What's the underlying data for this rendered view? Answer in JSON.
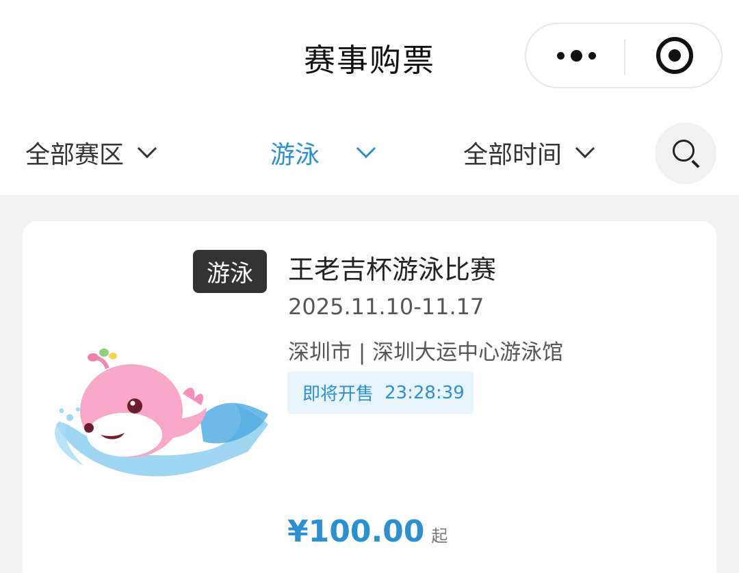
{
  "header": {
    "title": "赛事购票",
    "capsule": {
      "more_icon": "more-dots-icon",
      "close_icon": "target-circle-icon"
    }
  },
  "filters": {
    "region": "全部赛区",
    "sport": "游泳",
    "time": "全部时间",
    "search_icon": "search-icon"
  },
  "event": {
    "tag": "游泳",
    "title": "王老吉杯游泳比赛",
    "date": "2025.11.10-11.17",
    "venue": "深圳市 | 深圳大运中心游泳馆",
    "sale_label": "即将开售",
    "countdown": "23:28:39",
    "price": "¥100.00",
    "price_suffix": "起"
  },
  "colors": {
    "accent": "#2e8fd0",
    "badge_bg": "#e8f4fb",
    "page_bg": "#f2f2f2"
  }
}
